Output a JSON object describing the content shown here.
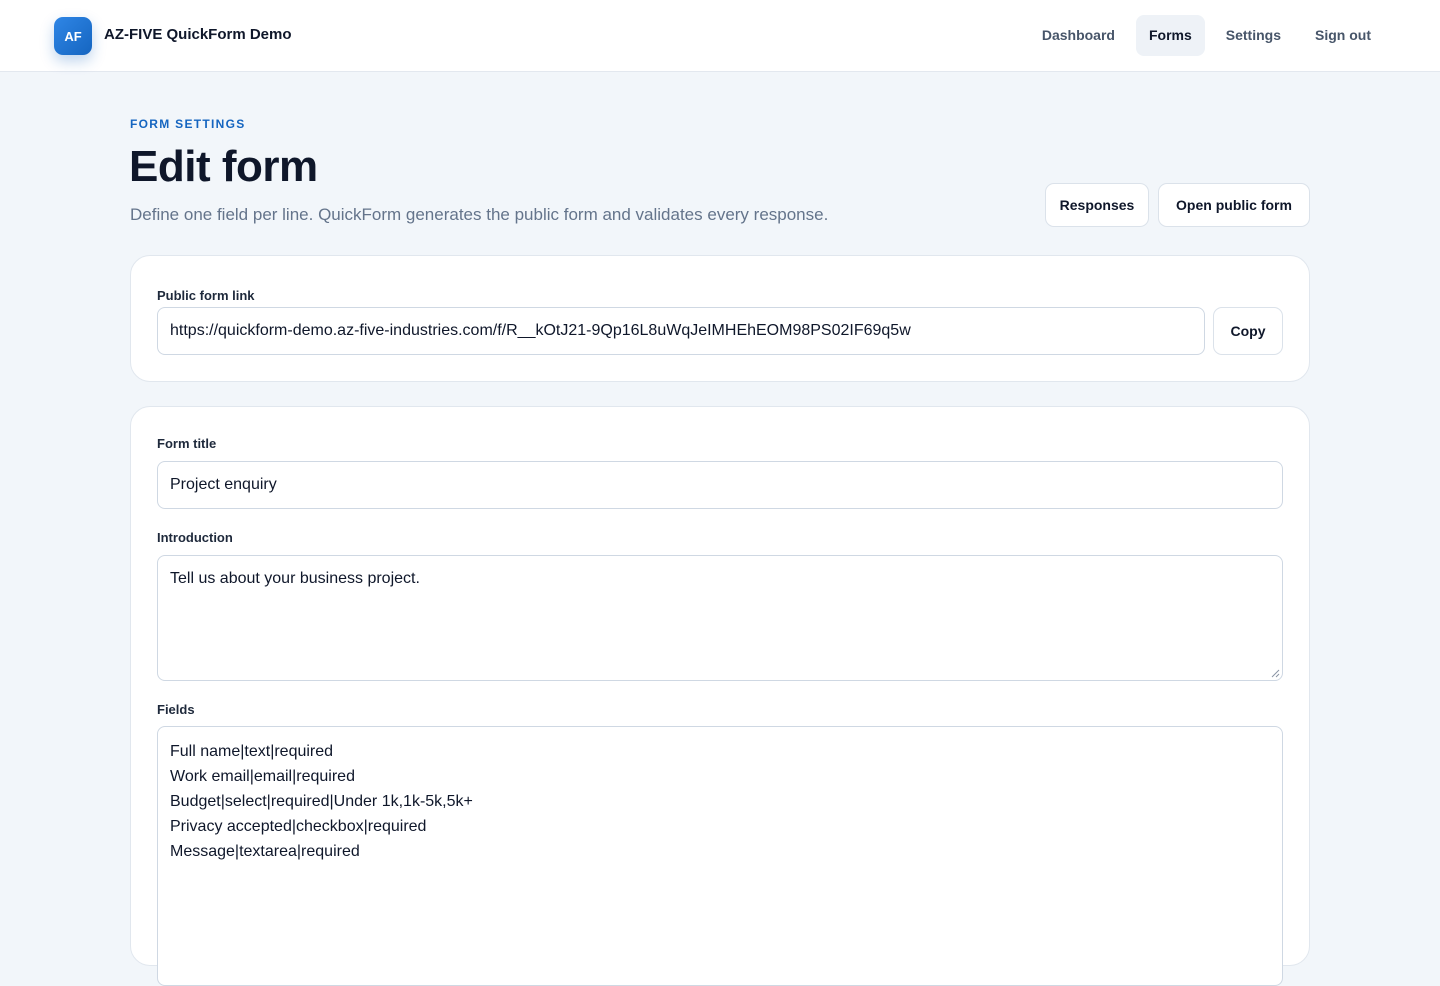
{
  "header": {
    "logo_text": "AF",
    "app_name": "AZ-FIVE QuickForm Demo",
    "nav": [
      {
        "label": "Dashboard"
      },
      {
        "label": "Forms",
        "active": true
      },
      {
        "label": "Settings"
      },
      {
        "label": "Sign out"
      }
    ]
  },
  "page": {
    "eyebrow": "FORM SETTINGS",
    "title": "Edit form",
    "subtitle": "Define one field per line. QuickForm generates the public form and validates every response.",
    "actions": {
      "responses_label": "Responses",
      "open_public_label": "Open public form"
    }
  },
  "link_card": {
    "label": "Public form link",
    "url": "https://quickform-demo.az-five-industries.com/f/R__kOtJ21-9Qp16L8uWqJeIMHEhEOM98PS02IF69q5w",
    "copy_label": "Copy"
  },
  "form_card": {
    "title_label": "Form title",
    "title_value": "Project enquiry",
    "intro_label": "Introduction",
    "intro_value": "Tell us about your business project.",
    "fields_label": "Fields",
    "fields_lines": [
      "Full name|text|required",
      "Work email|email|required",
      "Budget|select|required|Under 1k,1k-5k,5k+",
      "Privacy accepted|checkbox|required",
      "Message|textarea|required"
    ]
  },
  "colors": {
    "accent": "#1565c0",
    "background": "#f2f6fa",
    "text": "#0f172a",
    "muted": "#64748b"
  }
}
